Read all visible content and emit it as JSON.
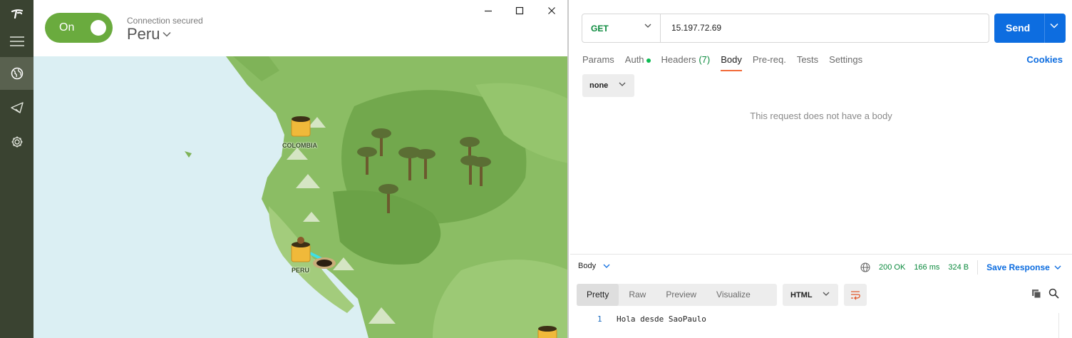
{
  "tunnelbear": {
    "toggle": {
      "label": "On",
      "color": "#6aab3e"
    },
    "status_text": "Connection secured",
    "country": "Peru",
    "sidebar": [
      {
        "icon": "tunnelbear-logo-icon"
      },
      {
        "icon": "menu-icon"
      },
      {
        "icon": "globe-icon",
        "active": true
      },
      {
        "icon": "share-icon"
      },
      {
        "icon": "gear-icon"
      }
    ],
    "window_controls": [
      "minimize-icon",
      "maximize-icon",
      "close-icon"
    ],
    "map": {
      "labels": {
        "colombia": "COLOMBIA",
        "peru": "PERU"
      },
      "colors": {
        "water": "#dbeff3",
        "land": "#8bbd64",
        "forest": "#6fa64c"
      }
    }
  },
  "postman": {
    "request": {
      "method": "GET",
      "url": "15.197.72.69",
      "send_label": "Send"
    },
    "tabs": [
      {
        "label": "Params"
      },
      {
        "label": "Auth"
      },
      {
        "label": "Headers",
        "count": "(7)"
      },
      {
        "label": "Body",
        "active": true
      },
      {
        "label": "Pre-req."
      },
      {
        "label": "Tests"
      },
      {
        "label": "Settings"
      }
    ],
    "cookies_label": "Cookies",
    "body_type": "none",
    "no_body_message": "This request does not have a body",
    "response": {
      "section_label": "Body",
      "status": "200 OK",
      "time": "166 ms",
      "size": "324 B",
      "save_label": "Save Response",
      "view_tabs": [
        "Pretty",
        "Raw",
        "Preview",
        "Visualize"
      ],
      "active_view": "Pretty",
      "format": "HTML",
      "lines": [
        {
          "number": "1",
          "text": "Hola desde SaoPaulo"
        }
      ]
    },
    "colors": {
      "accent": "#0d6de0",
      "success": "#0b8a3d",
      "tab_underline": "#f26b3a"
    }
  }
}
